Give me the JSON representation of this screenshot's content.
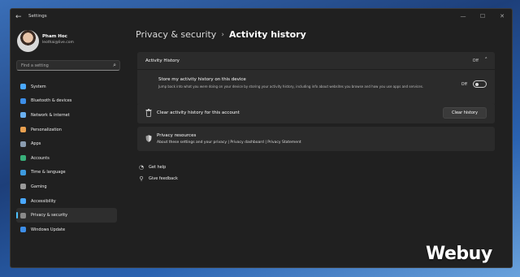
{
  "window": {
    "app_title": "Settings",
    "controls": [
      "—",
      "☐",
      "✕"
    ]
  },
  "profile": {
    "name": "Pham Hoc",
    "email": "leothai@live.com"
  },
  "search": {
    "placeholder": "Find a setting"
  },
  "sidebar": {
    "items": [
      {
        "label": "System",
        "icon": "monitor-icon",
        "color": "#4aa8ff"
      },
      {
        "label": "Bluetooth & devices",
        "icon": "bluetooth-icon",
        "color": "#3d8ee8"
      },
      {
        "label": "Network & internet",
        "icon": "wifi-icon",
        "color": "#6ab0f0"
      },
      {
        "label": "Personalization",
        "icon": "brush-icon",
        "color": "#e8a050"
      },
      {
        "label": "Apps",
        "icon": "apps-icon",
        "color": "#8a9cb0"
      },
      {
        "label": "Accounts",
        "icon": "person-icon",
        "color": "#38b07a"
      },
      {
        "label": "Time & language",
        "icon": "globe-clock-icon",
        "color": "#3d9be0"
      },
      {
        "label": "Gaming",
        "icon": "gamepad-icon",
        "color": "#9a9a9a"
      },
      {
        "label": "Accessibility",
        "icon": "accessibility-icon",
        "color": "#4aa8ff"
      },
      {
        "label": "Privacy & security",
        "icon": "shield-icon",
        "color": "#8a8a8a",
        "active": true
      },
      {
        "label": "Windows Update",
        "icon": "update-icon",
        "color": "#3d8ee8"
      }
    ]
  },
  "breadcrumb": {
    "parent": "Privacy & security",
    "separator": "›",
    "current": "Activity history"
  },
  "activity_history": {
    "title": "Activity History",
    "state": "Off",
    "store": {
      "title": "Store my activity history on this device",
      "description": "Jump back into what you were doing on your device by storing your activity history, including info about websites you browse and how you use apps and services.",
      "toggle_state": "Off"
    }
  },
  "clear": {
    "label": "Clear activity history for this account",
    "button": "Clear history"
  },
  "privacy": {
    "title": "Privacy resources",
    "links": "About these settings and your privacy | Privacy dashboard | Privacy Statement"
  },
  "help": {
    "get_help": "Get help",
    "give_feedback": "Give feedback"
  },
  "watermark": "Webuy"
}
